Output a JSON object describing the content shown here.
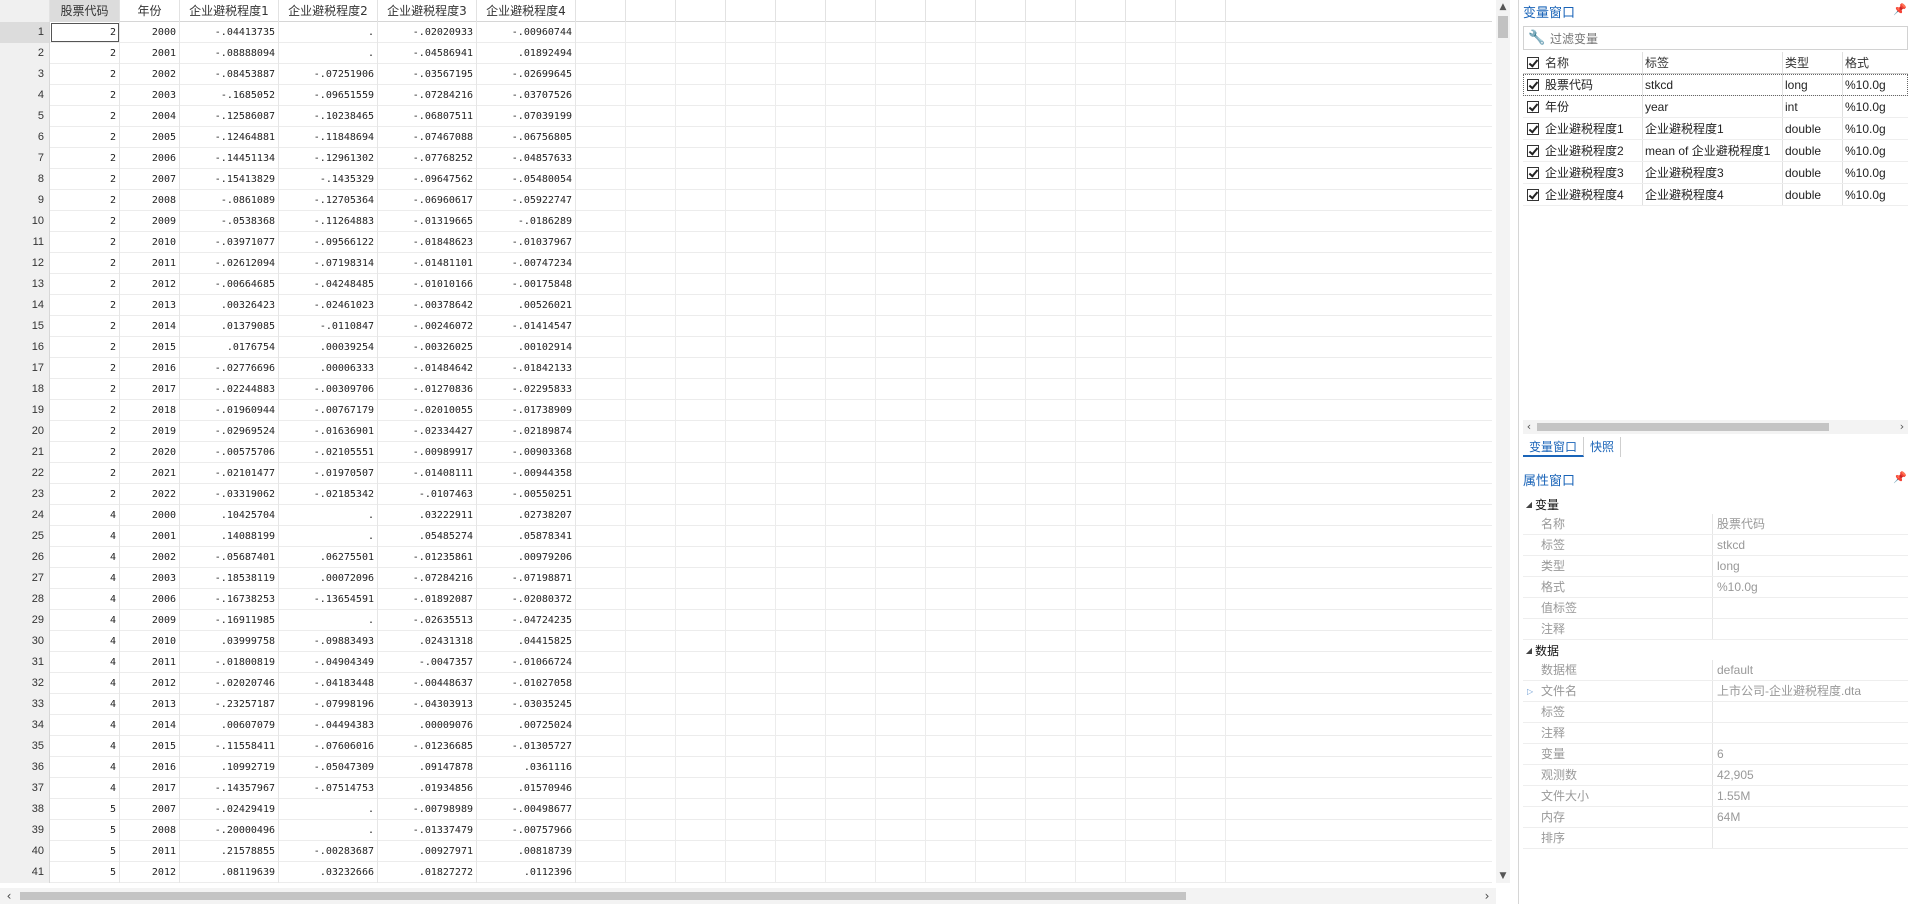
{
  "grid": {
    "columns": [
      "股票代码",
      "年份",
      "企业避税程度1",
      "企业避税程度2",
      "企业避税程度3",
      "企业避税程度4"
    ],
    "rows": [
      [
        "1",
        "2",
        "2000",
        "-.04413735",
        ".",
        "-.02020933",
        "-.00960744"
      ],
      [
        "2",
        "2",
        "2001",
        "-.08888094",
        ".",
        "-.04586941",
        ".01892494"
      ],
      [
        "3",
        "2",
        "2002",
        "-.08453887",
        "-.07251906",
        "-.03567195",
        "-.02699645"
      ],
      [
        "4",
        "2",
        "2003",
        "-.1685052",
        "-.09651559",
        "-.07284216",
        "-.03707526"
      ],
      [
        "5",
        "2",
        "2004",
        "-.12586087",
        "-.10238465",
        "-.06807511",
        "-.07039199"
      ],
      [
        "6",
        "2",
        "2005",
        "-.12464881",
        "-.11848694",
        "-.07467088",
        "-.06756805"
      ],
      [
        "7",
        "2",
        "2006",
        "-.14451134",
        "-.12961302",
        "-.07768252",
        "-.04857633"
      ],
      [
        "8",
        "2",
        "2007",
        "-.15413829",
        "-.1435329",
        "-.09647562",
        "-.05480054"
      ],
      [
        "9",
        "2",
        "2008",
        "-.0861089",
        "-.12705364",
        "-.06960617",
        "-.05922747"
      ],
      [
        "10",
        "2",
        "2009",
        "-.0538368",
        "-.11264883",
        "-.01319665",
        "-.0186289"
      ],
      [
        "11",
        "2",
        "2010",
        "-.03971077",
        "-.09566122",
        "-.01848623",
        "-.01037967"
      ],
      [
        "12",
        "2",
        "2011",
        "-.02612094",
        "-.07198314",
        "-.01481101",
        "-.00747234"
      ],
      [
        "13",
        "2",
        "2012",
        "-.00664685",
        "-.04248485",
        "-.01010166",
        "-.00175848"
      ],
      [
        "14",
        "2",
        "2013",
        ".00326423",
        "-.02461023",
        "-.00378642",
        ".00526021"
      ],
      [
        "15",
        "2",
        "2014",
        ".01379085",
        "-.0110847",
        "-.00246072",
        "-.01414547"
      ],
      [
        "16",
        "2",
        "2015",
        ".0176754",
        ".00039254",
        "-.00326025",
        ".00102914"
      ],
      [
        "17",
        "2",
        "2016",
        "-.02776696",
        ".00006333",
        "-.01484642",
        "-.01842133"
      ],
      [
        "18",
        "2",
        "2017",
        "-.02244883",
        "-.00309706",
        "-.01270836",
        "-.02295833"
      ],
      [
        "19",
        "2",
        "2018",
        "-.01960944",
        "-.00767179",
        "-.02010055",
        "-.01738909"
      ],
      [
        "20",
        "2",
        "2019",
        "-.02969524",
        "-.01636901",
        "-.02334427",
        "-.02189874"
      ],
      [
        "21",
        "2",
        "2020",
        "-.00575706",
        "-.02105551",
        "-.00989917",
        "-.00903368"
      ],
      [
        "22",
        "2",
        "2021",
        "-.02101477",
        "-.01970507",
        "-.01408111",
        "-.00944358"
      ],
      [
        "23",
        "2",
        "2022",
        "-.03319062",
        "-.02185342",
        "-.0107463",
        "-.00550251"
      ],
      [
        "24",
        "4",
        "2000",
        ".10425704",
        ".",
        ".03222911",
        ".02738207"
      ],
      [
        "25",
        "4",
        "2001",
        ".14088199",
        ".",
        ".05485274",
        ".05878341"
      ],
      [
        "26",
        "4",
        "2002",
        "-.05687401",
        ".06275501",
        "-.01235861",
        ".00979206"
      ],
      [
        "27",
        "4",
        "2003",
        "-.18538119",
        ".00072096",
        "-.07284216",
        "-.07198871"
      ],
      [
        "28",
        "4",
        "2006",
        "-.16738253",
        "-.13654591",
        "-.01892087",
        "-.02080372"
      ],
      [
        "29",
        "4",
        "2009",
        "-.16911985",
        ".",
        "-.02635513",
        "-.04724235"
      ],
      [
        "30",
        "4",
        "2010",
        ".03999758",
        "-.09883493",
        ".02431318",
        ".04415825"
      ],
      [
        "31",
        "4",
        "2011",
        "-.01800819",
        "-.04904349",
        "-.0047357",
        "-.01066724"
      ],
      [
        "32",
        "4",
        "2012",
        "-.02020746",
        "-.04183448",
        "-.00448637",
        "-.01027058"
      ],
      [
        "33",
        "4",
        "2013",
        "-.23257187",
        "-.07998196",
        "-.04303913",
        "-.03035245"
      ],
      [
        "34",
        "4",
        "2014",
        ".00607079",
        "-.04494383",
        ".00009076",
        ".00725024"
      ],
      [
        "35",
        "4",
        "2015",
        "-.11558411",
        "-.07606016",
        "-.01236685",
        "-.01305727"
      ],
      [
        "36",
        "4",
        "2016",
        ".10992719",
        "-.05047309",
        ".09147878",
        ".0361116"
      ],
      [
        "37",
        "4",
        "2017",
        "-.14357967",
        "-.07514753",
        ".01934856",
        ".01570946"
      ],
      [
        "38",
        "5",
        "2007",
        "-.02429419",
        ".",
        "-.00798989",
        "-.00498677"
      ],
      [
        "39",
        "5",
        "2008",
        "-.20000496",
        ".",
        "-.01337479",
        "-.00757966"
      ],
      [
        "40",
        "5",
        "2011",
        ".21578855",
        "-.00283687",
        ".00927971",
        ".00818739"
      ],
      [
        "41",
        "5",
        "2012",
        ".08119639",
        ".03232666",
        ".01827272",
        ".0112396"
      ]
    ]
  },
  "variables_window": {
    "title": "变量窗口",
    "filter_placeholder": "过滤变量",
    "headers": {
      "name": "名称",
      "label": "标签",
      "type": "类型",
      "format": "格式"
    },
    "variables": [
      {
        "name": "股票代码",
        "label": "stkcd",
        "type": "long",
        "format": "%10.0g"
      },
      {
        "name": "年份",
        "label": "year",
        "type": "int",
        "format": "%10.0g"
      },
      {
        "name": "企业避税程度1",
        "label": "企业避税程度1",
        "type": "double",
        "format": "%10.0g"
      },
      {
        "name": "企业避税程度2",
        "label": "mean of 企业避税程度1",
        "type": "double",
        "format": "%10.0g"
      },
      {
        "name": "企业避税程度3",
        "label": "企业避税程度3",
        "type": "double",
        "format": "%10.0g"
      },
      {
        "name": "企业避税程度4",
        "label": "企业避税程度4",
        "type": "double",
        "format": "%10.0g"
      }
    ],
    "tabs": [
      "变量窗口",
      "快照"
    ]
  },
  "properties_window": {
    "title": "属性窗口",
    "variable_group": {
      "title": "变量",
      "rows": [
        {
          "key": "名称",
          "value": "股票代码"
        },
        {
          "key": "标签",
          "value": "stkcd"
        },
        {
          "key": "类型",
          "value": "long"
        },
        {
          "key": "格式",
          "value": "%10.0g"
        },
        {
          "key": "值标签",
          "value": ""
        },
        {
          "key": "注释",
          "value": ""
        }
      ]
    },
    "data_group": {
      "title": "数据",
      "rows": [
        {
          "key": "数据框",
          "value": "default"
        },
        {
          "key": "文件名",
          "value": "上市公司-企业避税程度.dta"
        },
        {
          "key": "标签",
          "value": ""
        },
        {
          "key": "注释",
          "value": ""
        },
        {
          "key": "变量",
          "value": "6"
        },
        {
          "key": "观测数",
          "value": "42,905"
        },
        {
          "key": "文件大小",
          "value": "1.55M"
        },
        {
          "key": "内存",
          "value": "64M"
        },
        {
          "key": "排序",
          "value": ""
        }
      ]
    }
  },
  "colors": {
    "accent": "#1a64b8",
    "row_header_bg": "#f0f0f0"
  },
  "icons": [
    "wrench-icon",
    "pin-icon",
    "checkbox-icon",
    "expand-triangle-icon"
  ]
}
